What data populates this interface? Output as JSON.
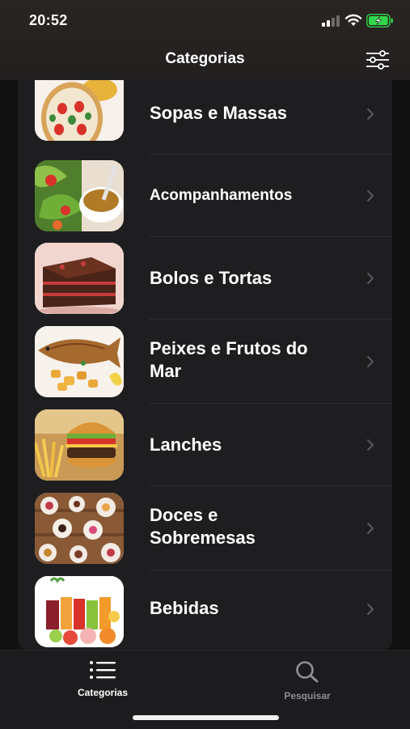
{
  "status_bar": {
    "time": "20:52"
  },
  "nav": {
    "title": "Categorias",
    "filter_icon": "sliders-icon"
  },
  "categories": [
    {
      "label": "Sopas e Massas",
      "image": "pizza"
    },
    {
      "label": "Acompanhamentos",
      "image": "salad-with-sauce"
    },
    {
      "label": "Bolos e Tortas",
      "image": "chocolate-cake"
    },
    {
      "label": "Peixes e Frutos do Mar",
      "image": "grilled-fish"
    },
    {
      "label": "Lanches",
      "image": "burger-and-fries"
    },
    {
      "label": "Doces e Sobremesas",
      "image": "sweets-platter"
    },
    {
      "label": "Bebidas",
      "image": "juices-and-fruits"
    }
  ],
  "tabbar": {
    "tabs": [
      {
        "label": "Categorias",
        "icon": "list-icon",
        "active": true
      },
      {
        "label": "Pesquisar",
        "icon": "magnifier-icon",
        "active": false
      }
    ]
  },
  "colors": {
    "accent_active": "#ffffff",
    "inactive": "#8e8e93",
    "battery": "#32d74b"
  }
}
